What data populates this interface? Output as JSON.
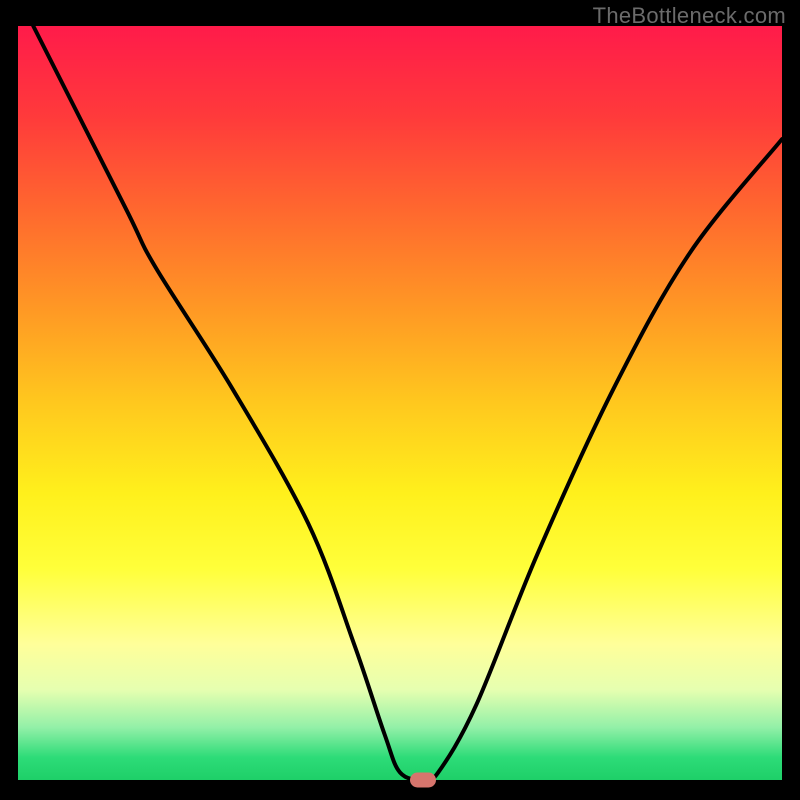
{
  "watermark": "TheBottleneck.com",
  "chart_data": {
    "type": "line",
    "title": "",
    "xlabel": "",
    "ylabel": "",
    "xlim": [
      0,
      100
    ],
    "ylim": [
      0,
      100
    ],
    "series": [
      {
        "name": "bottleneck-curve",
        "x": [
          2,
          14,
          18,
          28,
          38,
          44,
          48,
          50,
          53,
          55,
          60,
          68,
          78,
          88,
          100
        ],
        "values": [
          100,
          76,
          68,
          52,
          34,
          18,
          6,
          1,
          0,
          1,
          10,
          30,
          52,
          70,
          85
        ]
      }
    ],
    "marker": {
      "x": 53,
      "y": 0,
      "color": "#d6756d"
    },
    "gradient_stops": [
      {
        "pct": 0,
        "color": "#ff1b4a"
      },
      {
        "pct": 12,
        "color": "#ff3a3b"
      },
      {
        "pct": 25,
        "color": "#ff6a2e"
      },
      {
        "pct": 38,
        "color": "#ff9a24"
      },
      {
        "pct": 50,
        "color": "#ffc81e"
      },
      {
        "pct": 62,
        "color": "#fff01c"
      },
      {
        "pct": 72,
        "color": "#ffff3a"
      },
      {
        "pct": 82,
        "color": "#ffff9a"
      },
      {
        "pct": 88,
        "color": "#e6ffb0"
      },
      {
        "pct": 93,
        "color": "#93f0a8"
      },
      {
        "pct": 97,
        "color": "#2ddc78"
      },
      {
        "pct": 100,
        "color": "#1ecf68"
      }
    ]
  }
}
